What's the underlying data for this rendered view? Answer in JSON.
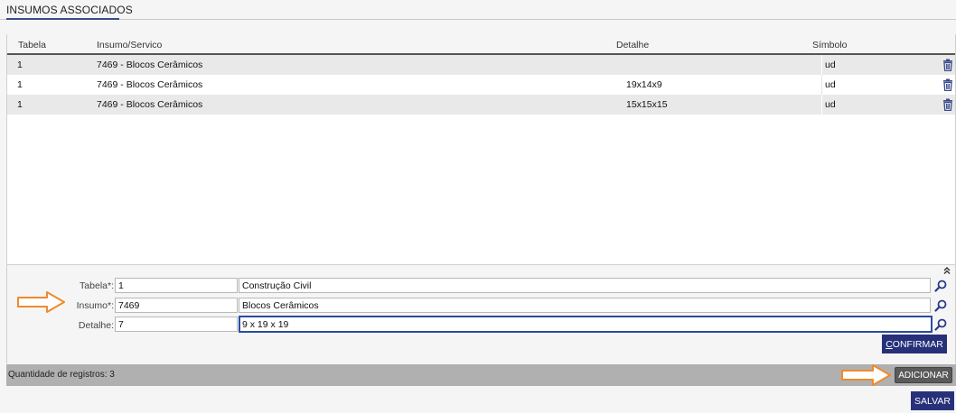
{
  "header": {
    "title": "INSUMOS ASSOCIADOS"
  },
  "grid": {
    "columns": [
      "Tabela",
      "Insumo/Servico",
      "Detalhe",
      "Símbolo"
    ],
    "rows": [
      {
        "tabela": "1",
        "insumo": "7469 - Blocos Cerâmicos",
        "detalhe": "",
        "simbolo": "ud"
      },
      {
        "tabela": "1",
        "insumo": "7469 - Blocos Cerâmicos",
        "detalhe": "19x14x9",
        "simbolo": "ud"
      },
      {
        "tabela": "1",
        "insumo": "7469 - Blocos Cerâmicos",
        "detalhe": "15x15x15",
        "simbolo": "ud"
      }
    ]
  },
  "form": {
    "tabela_label": "Tabela*:",
    "tabela_code": "1",
    "tabela_desc": "Construção Civil",
    "insumo_label": "Insumo*:",
    "insumo_code": "7469",
    "insumo_desc": "Blocos Cerâmicos",
    "detalhe_label": "Detalhe:",
    "detalhe_code": "7",
    "detalhe_desc": "9 x 19 x 19",
    "confirm_first": "C",
    "confirm_rest": "ONFIRMAR"
  },
  "status": {
    "count_text": "Quantidade de registros: 3",
    "add_label": "ADICIONAR"
  },
  "footer": {
    "save_label": "SALVAR"
  },
  "colors": {
    "accent": "#27317a",
    "arrow": "#f08a2c",
    "status_bar": "#b0b0b0"
  },
  "icons": {
    "row_action": "trash-icon",
    "lookup": "search-icon",
    "collapse": "double-chevron-up-icon"
  }
}
